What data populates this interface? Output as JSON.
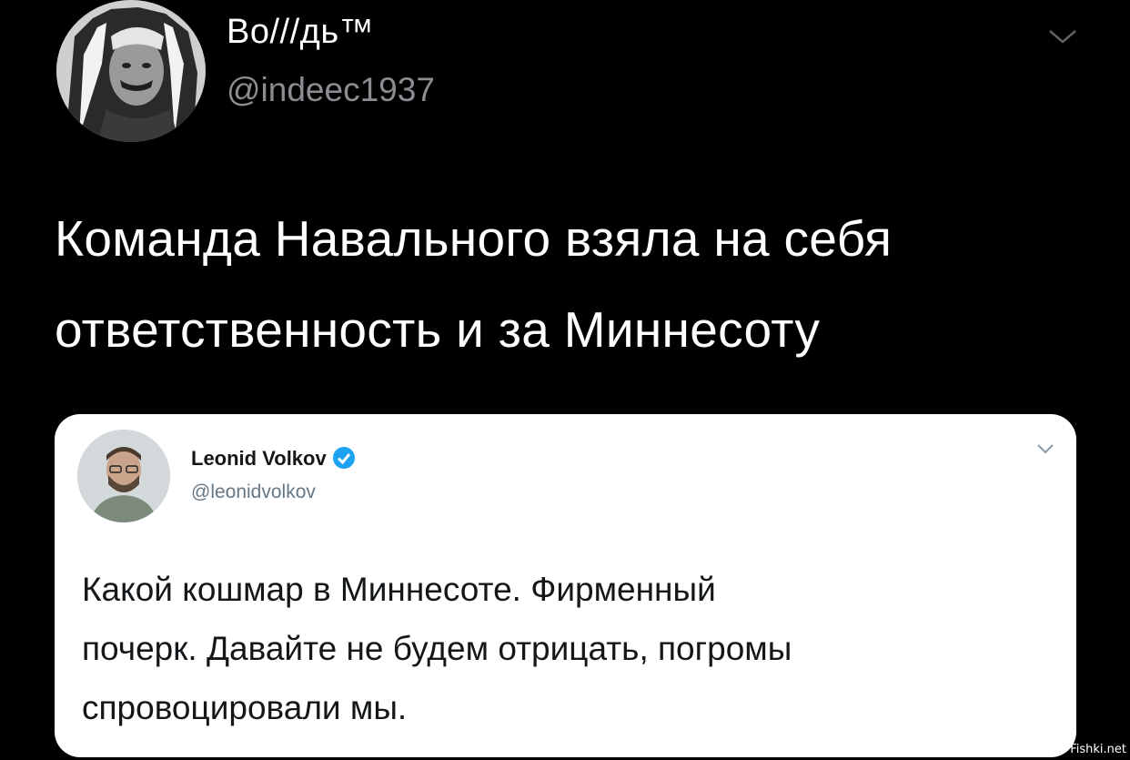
{
  "tweet": {
    "author_name": "Во///дь™",
    "author_handle": "@indeec1937",
    "text_lines": [
      "Команда Навального взяла на себя",
      "ответственность и за Миннесоту"
    ],
    "menu_icon": "chevron-down-icon"
  },
  "quoted": {
    "author_name": "Leonid Volkov",
    "author_handle": "@leonidvolkov",
    "verified": true,
    "verified_color": "#1da1f2",
    "text_lines": [
      "Какой кошмар в Миннесоте. Фирменный",
      "почерк. Давайте не будем отрицать, погромы",
      "спровоцировали мы."
    ],
    "menu_icon": "chevron-down-icon"
  },
  "watermark": "Fishki.net",
  "colors": {
    "background": "#000000",
    "text": "#ffffff",
    "handle": "#8a8d91",
    "card_background": "#ffffff"
  }
}
